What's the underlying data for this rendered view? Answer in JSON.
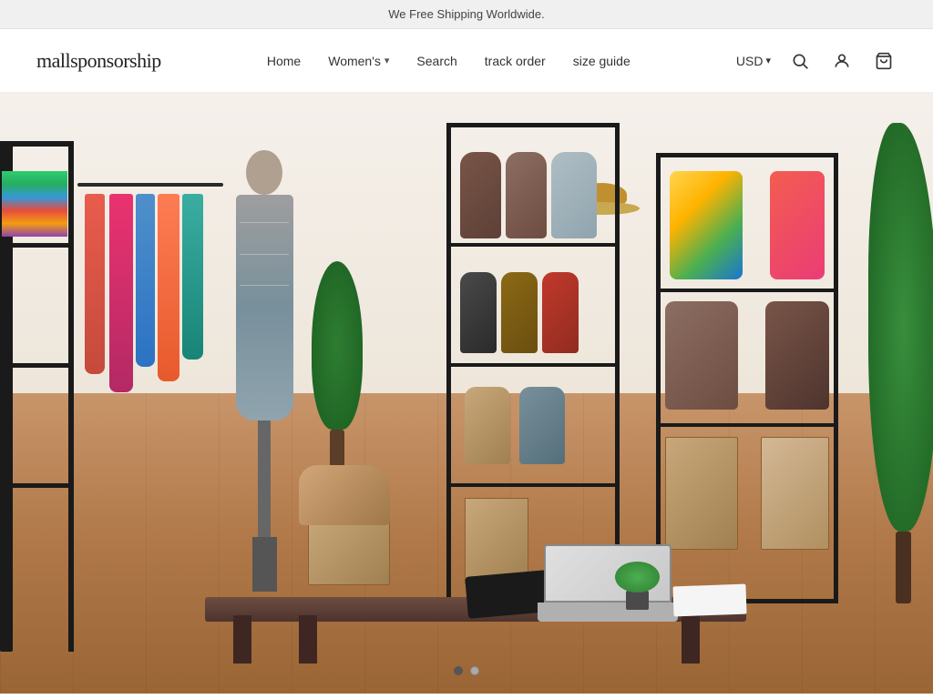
{
  "banner": {
    "text": "We Free Shipping Worldwide."
  },
  "header": {
    "logo": "mallsponsorship",
    "nav": {
      "home": "Home",
      "womens": "Women's",
      "search": "Search",
      "track_order": "track order",
      "size_guide": "size guide"
    },
    "currency": "USD",
    "icons": {
      "search": "search-icon",
      "user": "user-icon",
      "cart": "cart-icon"
    }
  },
  "hero": {
    "alt": "Fashion store interior with clothing racks and shoe displays"
  },
  "carousel": {
    "dots": [
      {
        "active": true,
        "label": "Slide 1"
      },
      {
        "active": false,
        "label": "Slide 2"
      }
    ]
  }
}
